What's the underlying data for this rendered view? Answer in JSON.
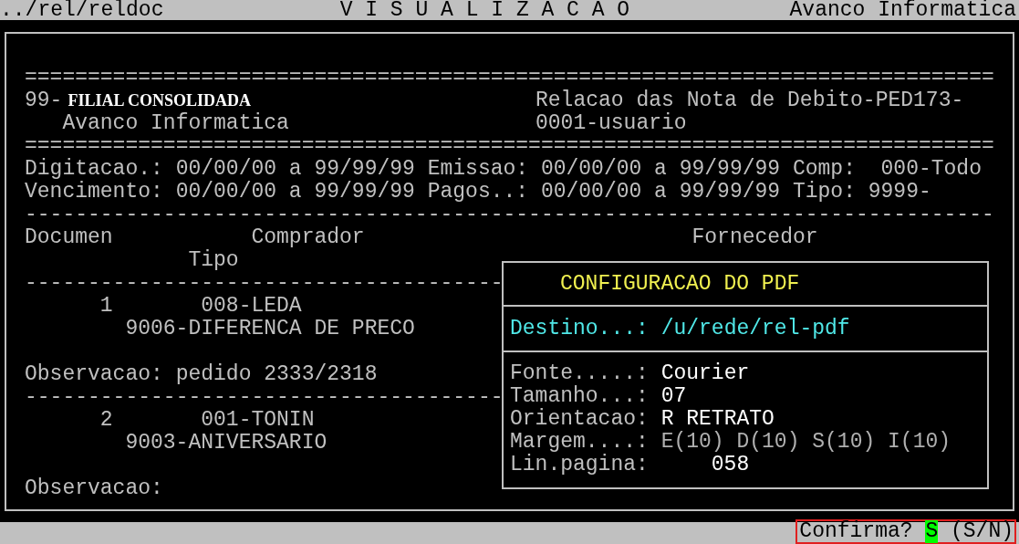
{
  "top_bar": {
    "path": "../rel/reldoc",
    "title": "V I S U A L I Z A C A O",
    "company": "Avanco Informatica"
  },
  "report": {
    "header": {
      "rule_top": "=============================================================================",
      "branch_code": "99-",
      "branch_name": "FILIAL CONSOLIDADA",
      "company": "Avanco Informatica",
      "report_title": "Relacao das Nota de Debito-PED173-",
      "report_user": "0001-usuario",
      "rule_bottom": "============================================================================="
    },
    "filter_lines": [
      "Digitacao.: 00/00/00 a 99/99/99 Emissao: 00/00/00 a 99/99/99 Comp:  000-Todo",
      "Vencimento: 00/00/00 a 99/99/99 Pagos..: 00/00/00 a 99/99/99 Tipo: 9999-"
    ],
    "rule": "-----------------------------------------------------------------------------",
    "columns": {
      "document": "Documen",
      "buyer": "Comprador",
      "supplier": "Fornecedor",
      "type": "Tipo"
    },
    "records": [
      {
        "separator": "--------------------------------------",
        "number": "1",
        "buyer": "008-LEDA",
        "type": "9006-DIFERENCA DE PRECO",
        "observation": "Observacao: pedido 2333/2318"
      },
      {
        "separator": "--------------------------------------",
        "number": "2",
        "buyer": "001-TONIN",
        "type": "9003-ANIVERSARIO",
        "observation": "Observacao:"
      }
    ]
  },
  "pdf_dialog": {
    "title": "CONFIGURACAO DO PDF",
    "destination": {
      "label": "Destino...:",
      "value": "/u/rede/rel-pdf"
    },
    "fields": [
      {
        "label": "Fonte.....:",
        "value": "Courier",
        "bright": true,
        "kind": "text"
      },
      {
        "label": "Tamanho...:",
        "value": "07",
        "bright": true,
        "kind": "text"
      },
      {
        "label": "Orientacao:",
        "value": "R RETRATO",
        "bright": true,
        "kind": "text"
      },
      {
        "label": "Margem....:",
        "value": "E(10) D(10) S(10) I(10)",
        "bright": false,
        "kind": "text"
      },
      {
        "label": "Lin.pagina:",
        "value": "058",
        "bright": true,
        "kind": "number"
      }
    ]
  },
  "prompt": {
    "label": "Confirma?",
    "value": "S",
    "hint": "(S/N)"
  }
}
